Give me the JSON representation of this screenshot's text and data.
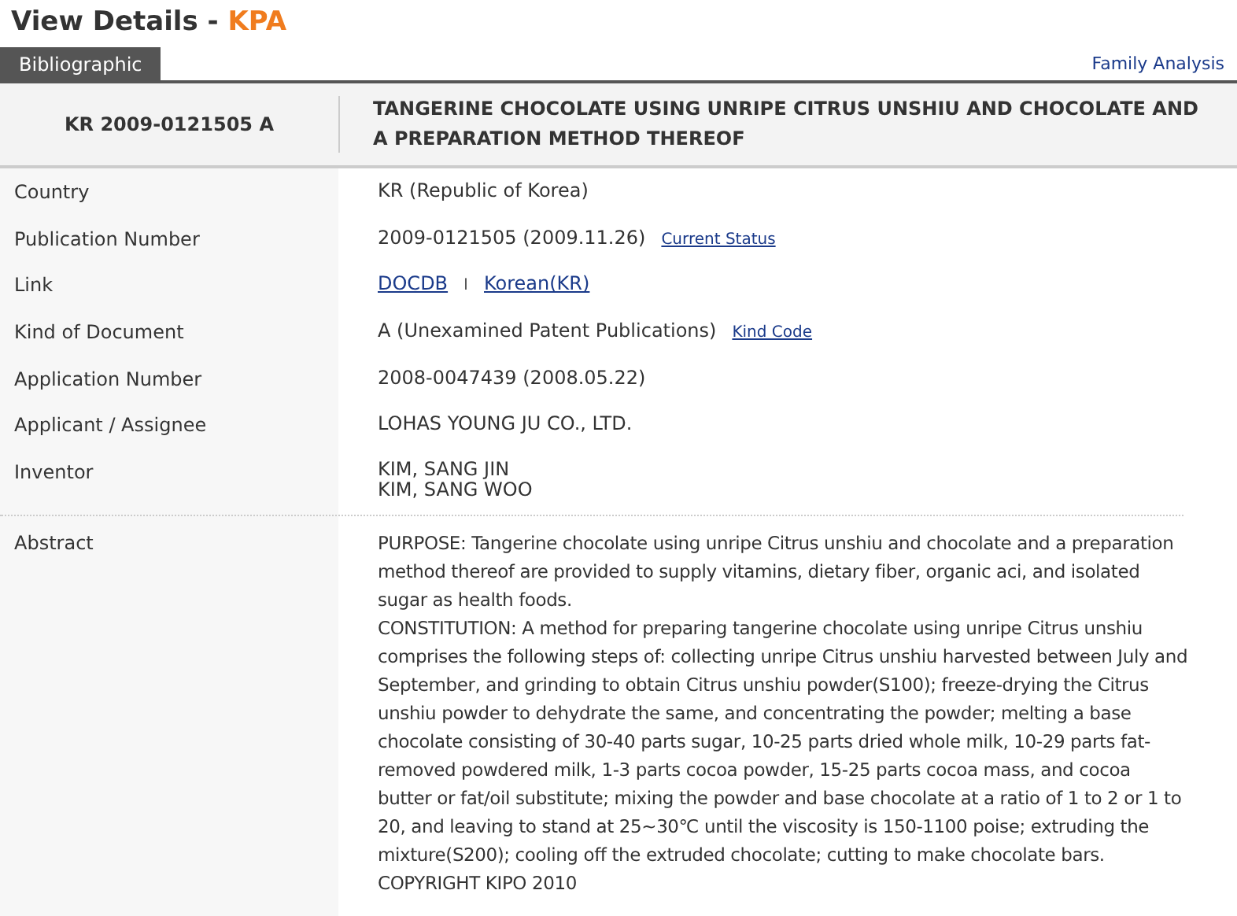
{
  "page_title": {
    "text": "View Details - ",
    "source": "KPA"
  },
  "tabs": [
    {
      "label": "Bibliographic",
      "selected": true
    }
  ],
  "family_link": "Family Analysis",
  "header": {
    "number": "KR 2009-0121505 A",
    "title": "TANGERINE CHOCOLATE USING UNRIPE CITRUS UNSHIU AND CHOCOLATE AND A PREPARATION METHOD THEREOF"
  },
  "rows": [
    {
      "label": "Country",
      "parts": [
        {
          "kind": "text",
          "text": "KR (Republic of Korea)"
        }
      ]
    },
    {
      "label": "Publication Number",
      "parts": [
        {
          "kind": "text",
          "text": "2009-0121505 (2009.11.26)"
        },
        {
          "kind": "small_link",
          "text": "Current Status"
        }
      ]
    },
    {
      "label": "Link",
      "parts": [
        {
          "kind": "link",
          "text": "DOCDB"
        },
        {
          "kind": "separator",
          "text": "I"
        },
        {
          "kind": "link",
          "text": "Korean(KR)"
        }
      ]
    },
    {
      "label": "Kind of Document",
      "parts": [
        {
          "kind": "text",
          "text": "A (Unexamined Patent Publications)"
        },
        {
          "kind": "small_link",
          "text": "Kind Code"
        }
      ]
    },
    {
      "label": "Application Number",
      "parts": [
        {
          "kind": "text",
          "text": "2008-0047439 (2008.05.22)"
        }
      ]
    },
    {
      "label": "Applicant / Assignee",
      "parts": [
        {
          "kind": "text",
          "text": "LOHAS YOUNG JU CO., LTD."
        }
      ]
    },
    {
      "label": "Inventor",
      "parts": [
        {
          "kind": "line",
          "text": "KIM, SANG JIN"
        },
        {
          "kind": "line",
          "text": "KIM, SANG WOO"
        }
      ]
    }
  ],
  "abstract": {
    "label": "Abstract",
    "paragraphs": [
      "PURPOSE: Tangerine chocolate using unripe Citrus unshiu and chocolate and a preparation method thereof are provided to supply vitamins, dietary fiber, organic aci, and isolated sugar as health foods.",
      "CONSTITUTION: A method for preparing tangerine chocolate using unripe Citrus unshiu comprises the following steps of: collecting unripe Citrus unshiu harvested between July and September, and grinding to obtain Citrus unshiu powder(S100); freeze-drying the Citrus unshiu powder to dehydrate the same, and concentrating the powder; melting a base chocolate consisting of 30-40 parts sugar, 10-25 parts dried whole milk, 10-29 parts fat-removed powdered milk, 1-3 parts cocoa powder, 15-25 parts cocoa mass, and cocoa butter or fat/oil substitute; mixing the powder and base chocolate at a ratio of 1 to 2 or 1 to 20, and leaving to stand at 25~30℃ until the viscosity is 150-1100 poise; extruding the mixture(S200); cooling off the extruded chocolate; cutting to make chocolate bars.",
      "COPYRIGHT KIPO 2010"
    ]
  }
}
